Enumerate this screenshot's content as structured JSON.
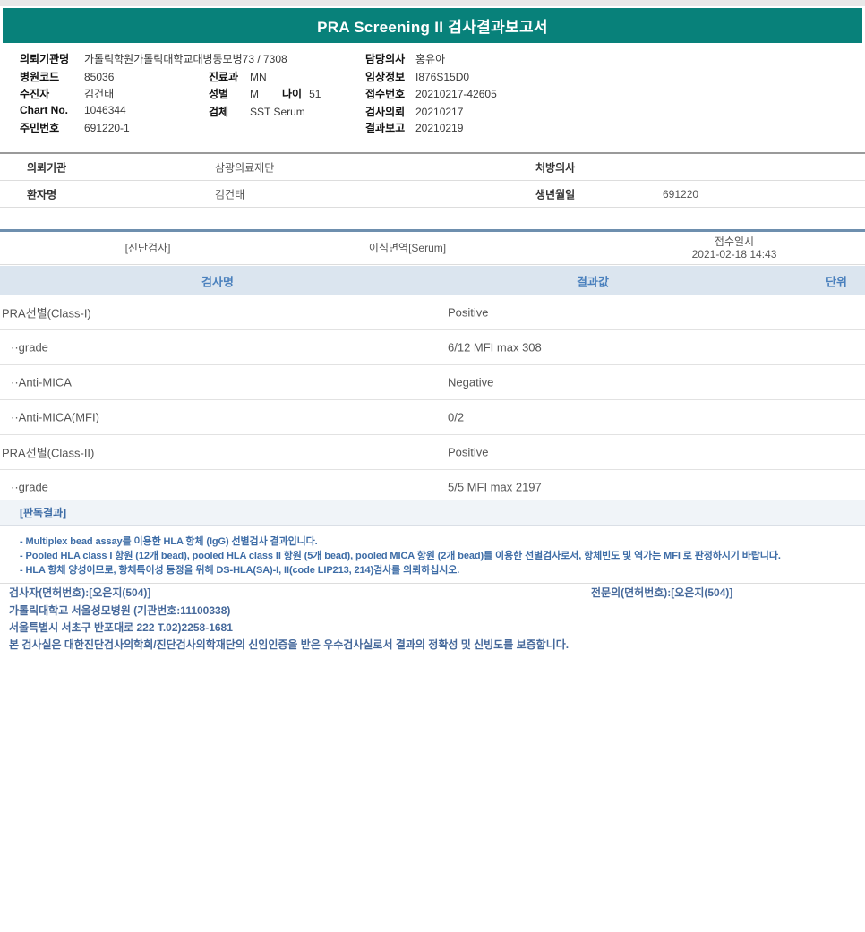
{
  "report_title": "PRA Screening II 검사결과보고서",
  "header": {
    "org_label": "의뢰기관명",
    "org_value": "가톨릭학원가톨릭대학교대병동모병73 / 7308",
    "hospital_code_label": "병원코드",
    "hospital_code_value": "85036",
    "patient_label": "수진자",
    "patient_value": "김건태",
    "chart_label": "Chart No.",
    "chart_value": "1046344",
    "resident_label": "주민번호",
    "resident_value": "691220-1",
    "dept_label": "진료과",
    "dept_value": "MN",
    "sex_label": "성별",
    "sex_value": "M",
    "age_label": "나이",
    "age_value": "51",
    "specimen_label": "검체",
    "specimen_value": "SST Serum",
    "doctor_label": "담당의사",
    "doctor_value": "홍유아",
    "clinical_label": "임상정보",
    "clinical_value": "I876S15D0",
    "accession_label": "접수번호",
    "accession_value": "20210217-42605",
    "request_label": "검사의뢰",
    "request_value": "20210217",
    "report_label": "결과보고",
    "report_value": "20210219"
  },
  "patient_table": {
    "row1": {
      "label1": "의뢰기관",
      "value1": "삼광의료재단",
      "label2": "처방의사",
      "value2": ""
    },
    "row2": {
      "label1": "환자명",
      "value1": "김건태",
      "label2": "생년월일",
      "value2": "691220"
    }
  },
  "section_band": {
    "category": "[진단검사]",
    "panel": "이식면역[Serum]",
    "receipt_label": "접수일시",
    "receipt_datetime": "2021-02-18 14:43"
  },
  "results": {
    "header": {
      "name": "검사명",
      "value": "결과값",
      "unit": "단위"
    },
    "rows": [
      {
        "name": "PRA선별(Class-I)",
        "value": "Positive",
        "unit": ""
      },
      {
        "name": "··grade",
        "value": "6/12 MFI max 308",
        "unit": ""
      },
      {
        "name": "··Anti-MICA",
        "value": "Negative",
        "unit": ""
      },
      {
        "name": "··Anti-MICA(MFI)",
        "value": "0/2",
        "unit": ""
      },
      {
        "name": "PRA선별(Class-II)",
        "value": "Positive",
        "unit": ""
      },
      {
        "name": "··grade",
        "value": "5/5 MFI max 2197",
        "unit": ""
      }
    ]
  },
  "interpretation": {
    "heading": "[판독결과]",
    "notes": [
      "- Multiplex bead assay를 이용한 HLA 항체 (IgG) 선별검사 결과입니다.",
      "- Pooled HLA class I 항원 (12개 bead), pooled HLA class II 항원 (5개 bead), pooled MICA 항원 (2개 bead)를 이용한 선별검사로서, 항체빈도 및 역가는 MFI 로 판정하시기 바랍니다.",
      "- HLA 항체 양성이므로, 항체특이성 동정을 위해 DS-HLA(SA)-I, II(code LIP213, 214)검사를 의뢰하십시오."
    ]
  },
  "footer": {
    "examiner": "검사자(면허번호):[오은지(504)]",
    "specialist": "전문의(면허번호):[오은지(504)]",
    "institution": "가톨릭대학교 서울성모병원 (기관번호:11100338)",
    "address": "서울특별시 서초구 반포대로 222 T.02)2258-1681",
    "certification": "본 검사실은 대한진단검사의학회/진단검사의학재단의 신임인증을 받은 우수검사실로서 결과의 정확성 및 신빙도를 보증합니다."
  },
  "colors": {
    "title_bar_teal": "#08817A",
    "results_header_bg": "#DBE5EF",
    "results_header_text": "#4A80BD",
    "divider_steel_blue": "#6E8FAE",
    "note_blue": "#3D6CA6",
    "footer_blue": "#46699B"
  }
}
